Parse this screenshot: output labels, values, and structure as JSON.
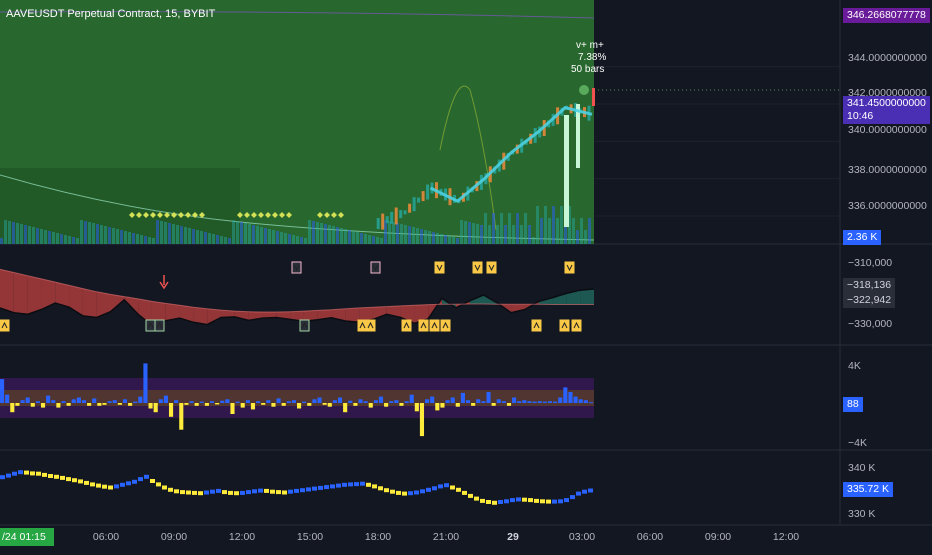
{
  "chart_header": {
    "symbol_title": "AAVEUSDT Perpetual Contract, 15, BYBIT"
  },
  "annotation": {
    "line1": "v+ m+",
    "line2": "7.38%",
    "line3": "50 bars"
  },
  "price_axis": {
    "labels": [
      "344.0000000000",
      "342.0000000000",
      "340.0000000000",
      "338.0000000000",
      "336.0000000000"
    ],
    "top_tag": "346.2668077778",
    "current_price": "341.4500000000",
    "countdown": "10:46",
    "volume_tag": "2.36 K"
  },
  "pane2_axis": {
    "labels": [
      "−310,000",
      "−330,000"
    ],
    "tag_a": "−318,136",
    "tag_b": "−322,942"
  },
  "pane3_axis": {
    "labels": [
      "4K",
      "−4K"
    ],
    "tag": "88"
  },
  "pane4_axis": {
    "labels": [
      "340 K",
      "330 K"
    ],
    "tag": "335.72 K"
  },
  "time_axis": {
    "current_label": "/24  01:15",
    "labels": [
      "06:00",
      "09:00",
      "12:00",
      "15:00",
      "18:00",
      "21:00",
      "29",
      "03:00",
      "06:00",
      "09:00",
      "12:00"
    ]
  },
  "colors": {
    "background": "#131722",
    "price_zone_green": "#2e7d32",
    "price_tag_purple": "#6a1b9a",
    "current_price_tag": "#4a2fb5",
    "volume_tag_blue": "#2962ff",
    "pane2_red": "#a33a3a",
    "pane2_teal": "#1f5f58",
    "hist_blue": "#2962ff",
    "hist_yellow": "#ffeb3b",
    "current_time_green": "#27a644"
  },
  "chart_data": [
    {
      "type": "line",
      "pane": "price",
      "ylim": [
        334.5,
        346.5
      ],
      "x": [
        0,
        8,
        16,
        24,
        32,
        40,
        48,
        56,
        60,
        64,
        68,
        72,
        76,
        80,
        84,
        88
      ],
      "values": [
        335.6,
        335.7,
        335.5,
        335.6,
        335.4,
        335.5,
        335.3,
        335.6,
        336.2,
        337.5,
        336.8,
        338.0,
        339.4,
        340.5,
        341.8,
        341.45
      ]
    },
    {
      "type": "area",
      "pane": "oscillator",
      "ylim": [
        -334000,
        -306000
      ],
      "values": [
        -324000,
        -325500,
        -326000,
        -324500,
        -322500,
        -323800,
        -326500,
        -327000,
        -325200,
        -321500,
        -326000,
        -329500,
        -328000,
        -327200,
        -328500,
        -329200,
        -327000,
        -326800,
        -327900,
        -327200,
        -327000,
        -327600,
        -328200,
        -327700,
        -327100,
        -328100,
        -328500,
        -327600,
        -326000,
        -327000,
        -328800,
        -327400,
        -321000,
        -324000,
        -321800,
        -320000,
        -322500,
        -325500,
        -324500,
        -322000,
        -320800,
        -319500,
        -318500,
        -318136
      ],
      "baseline": [
        -312000,
        -313000,
        -314000,
        -315000,
        -316000,
        -317000,
        -318000,
        -319000,
        -319800,
        -320500,
        -321200,
        -322000,
        -322600,
        -323200,
        -323800,
        -324300,
        -324700,
        -325000,
        -325200,
        -325300,
        -325300,
        -325200,
        -325000,
        -324800,
        -324600,
        -324300,
        -324000,
        -323800,
        -323600,
        -323400,
        -323200,
        -323000,
        -322900,
        -322900,
        -322800,
        -322800,
        -322900,
        -322900,
        -322900,
        -322900,
        -322950,
        -322950,
        -322942,
        -322942
      ]
    },
    {
      "type": "bar",
      "pane": "histogram",
      "ylim": [
        -5000,
        5000
      ],
      "values": [
        2600,
        900,
        -1000,
        -300,
        300,
        600,
        -400,
        200,
        -500,
        800,
        300,
        -500,
        200,
        -300,
        400,
        600,
        300,
        -300,
        500,
        -300,
        -200,
        200,
        300,
        -200,
        400,
        -300,
        150,
        700,
        4300,
        -600,
        -1000,
        400,
        800,
        -1500,
        300,
        -2900,
        -200,
        200,
        -300,
        150,
        -300,
        200,
        -150,
        250,
        400,
        -1200,
        150,
        -500,
        300,
        -700,
        200,
        -200,
        300,
        -400,
        500,
        -300,
        200,
        300,
        -600,
        150,
        -300,
        400,
        600,
        -200,
        -400,
        300,
        600,
        -1000,
        250,
        -300,
        400,
        200,
        -500,
        300,
        700,
        -400,
        200,
        300,
        -300,
        200,
        900,
        -900,
        -3600,
        400,
        700,
        -800,
        -500,
        300,
        600,
        -400,
        1100,
        300,
        -300,
        400,
        200,
        1200,
        -300,
        400,
        200,
        -300,
        600,
        200,
        300,
        200,
        150,
        200,
        150,
        200,
        150,
        600,
        1700,
        1200,
        700,
        400,
        300,
        88
      ]
    },
    {
      "type": "scatter",
      "pane": "cumulative",
      "ylim": [
        328000,
        345000
      ],
      "values": [
        339200,
        339600,
        340100,
        340500,
        340400,
        340200,
        340100,
        339800,
        339500,
        339300,
        339000,
        338700,
        338400,
        338100,
        337700,
        337300,
        337000,
        336700,
        336500,
        336800,
        337200,
        337600,
        338000,
        338700,
        339300,
        338200,
        337300,
        336500,
        335900,
        335500,
        335300,
        335200,
        335100,
        335000,
        335200,
        335400,
        335600,
        335300,
        335100,
        335000,
        335100,
        335300,
        335500,
        335700,
        335600,
        335400,
        335300,
        335200,
        335400,
        335600,
        335800,
        336000,
        336200,
        336400,
        336600,
        336800,
        337000,
        337200,
        337300,
        337400,
        337500,
        337200,
        336800,
        336300,
        335800,
        335400,
        335100,
        334900,
        335000,
        335200,
        335500,
        335900,
        336300,
        336800,
        337100,
        336500,
        335900,
        335100,
        334300,
        333600,
        333000,
        332700,
        332500,
        332700,
        332900,
        333200,
        333400,
        333300,
        333200,
        333000,
        332900,
        332800,
        332800,
        332900,
        333200,
        334000,
        334900,
        335400,
        335720
      ]
    }
  ]
}
